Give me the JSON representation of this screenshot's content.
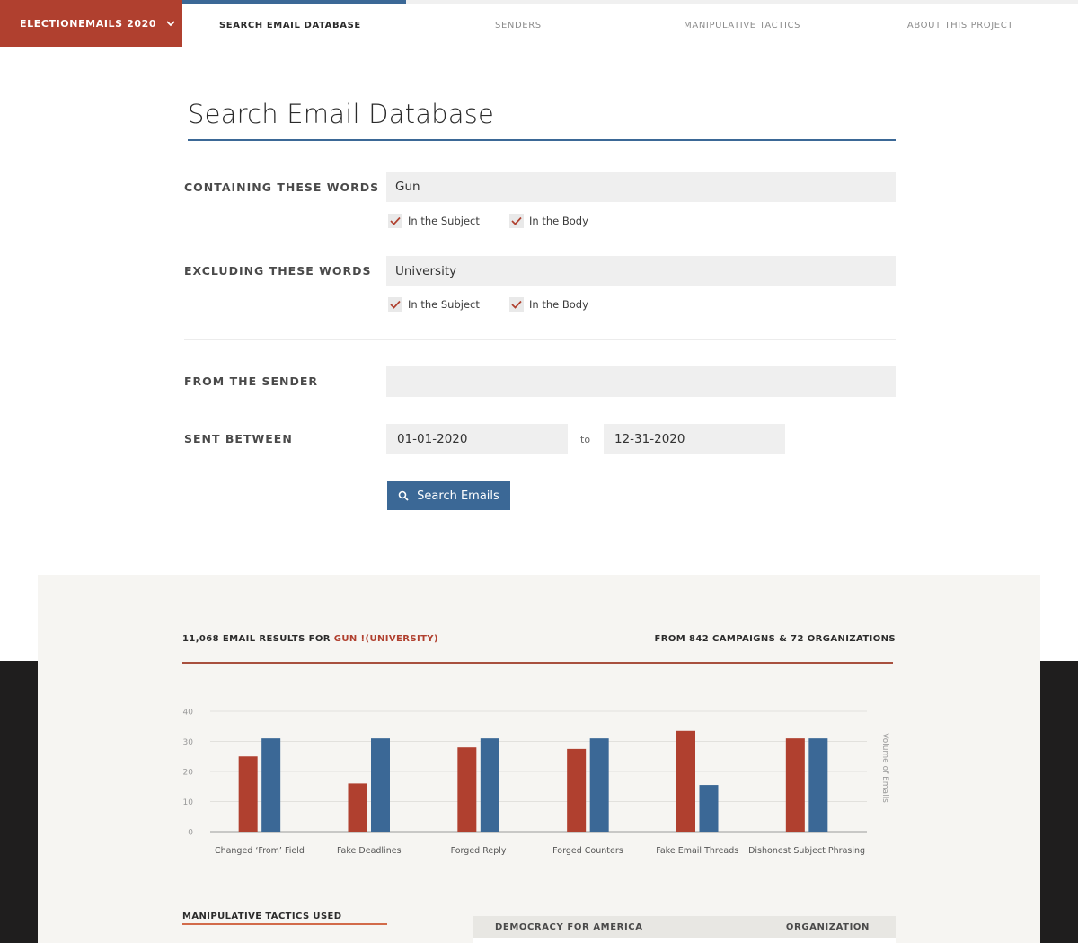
{
  "nav": {
    "brand": "ELECTIONEMAILS 2020",
    "tabs": [
      "SEARCH EMAIL DATABASE",
      "SENDERS",
      "MANIPULATIVE TACTICS",
      "ABOUT THIS PROJECT"
    ],
    "active_tab": 0
  },
  "page_title": "Search Email Database",
  "form": {
    "containing": {
      "label": "CONTAINING THESE WORDS",
      "value": "Gun",
      "subject_label": "In the Subject",
      "body_label": "In the Body",
      "subject_checked": true,
      "body_checked": true
    },
    "excluding": {
      "label": "EXCLUDING THESE WORDS",
      "value": "University",
      "subject_label": "In the Subject",
      "body_label": "In the Body",
      "subject_checked": true,
      "body_checked": true
    },
    "sender": {
      "label": "FROM THE SENDER",
      "value": ""
    },
    "dates": {
      "label": "SENT BETWEEN",
      "from": "01-01-2020",
      "to_word": "to",
      "to": "12-31-2020"
    },
    "search_button": "Search Emails"
  },
  "results": {
    "count_text": "11,068 EMAIL RESULTS FOR ",
    "query": "GUN !(UNIVERSITY)",
    "sources": "FROM 842 CAMPAIGNS & 72 ORGANIZATIONS"
  },
  "chart_data": {
    "type": "bar",
    "categories": [
      "Changed ‘From’ Field",
      "Fake Deadlines",
      "Forged Reply",
      "Forged Counters",
      "Fake Email Threads",
      "Dishonest Subject Phrasing"
    ],
    "series": [
      {
        "values": [
          25,
          16,
          28,
          27.5,
          33.5,
          31
        ],
        "color": "#b0402f"
      },
      {
        "values": [
          31,
          31,
          31,
          31,
          15.5,
          31
        ],
        "color": "#3b6896"
      }
    ],
    "yticks": [
      0,
      10,
      20,
      30,
      40
    ],
    "ylim": [
      0,
      40
    ],
    "ylabel": "Volume of Emails",
    "xlabel": "",
    "grid": true
  },
  "tactics_heading": "MANIPULATIVE TACTICS USED",
  "table": {
    "name": "DEMOCRACY FOR AMERICA",
    "type": "ORGANIZATION"
  },
  "colors": {
    "red": "#b0402f",
    "blue": "#3b6896"
  },
  "icons": {
    "brand_chevron": "chevron-down-icon",
    "search": "search-icon",
    "check": "check-icon"
  }
}
